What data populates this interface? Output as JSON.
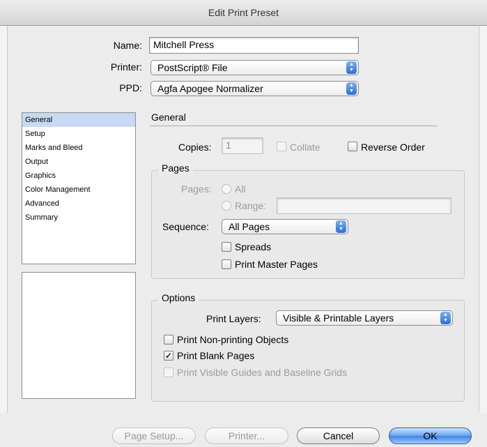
{
  "window": {
    "title": "Edit Print Preset"
  },
  "preset": {
    "name_label": "Name:",
    "name_value": "Mitchell Press",
    "printer_label": "Printer:",
    "printer_value": "PostScript® File",
    "ppd_label": "PPD:",
    "ppd_value": "Agfa Apogee Normalizer"
  },
  "sidebar": {
    "items": [
      {
        "label": "General",
        "selected": true
      },
      {
        "label": "Setup"
      },
      {
        "label": "Marks and Bleed"
      },
      {
        "label": "Output"
      },
      {
        "label": "Graphics"
      },
      {
        "label": "Color Management"
      },
      {
        "label": "Advanced"
      },
      {
        "label": "Summary"
      }
    ]
  },
  "general": {
    "heading": "General",
    "copies_label": "Copies:",
    "copies_value": "1",
    "collate_label": "Collate",
    "collate_checked": false,
    "reverse_order_label": "Reverse Order",
    "reverse_order_checked": false
  },
  "pages": {
    "group_title": "Pages",
    "pages_label": "Pages:",
    "all_label": "All",
    "range_label": "Range:",
    "range_value": "",
    "sequence_label": "Sequence:",
    "sequence_value": "All Pages",
    "spreads_label": "Spreads",
    "spreads_checked": false,
    "master_pages_label": "Print Master Pages",
    "master_pages_checked": false
  },
  "options": {
    "group_title": "Options",
    "print_layers_label": "Print Layers:",
    "print_layers_value": "Visible & Printable Layers",
    "non_printing_label": "Print Non-printing Objects",
    "non_printing_checked": false,
    "blank_pages_label": "Print Blank Pages",
    "blank_pages_checked": true,
    "guides_label": "Print Visible Guides and Baseline Grids",
    "guides_checked": false
  },
  "buttons": {
    "page_setup": "Page Setup...",
    "printer": "Printer...",
    "cancel": "Cancel",
    "ok": "OK"
  },
  "icons": {
    "popup_arrows": "updown-arrows-icon",
    "checkmark": "checkmark-icon"
  },
  "colors": {
    "accent": "#3f83e4",
    "selection": "#c7d9f3"
  }
}
